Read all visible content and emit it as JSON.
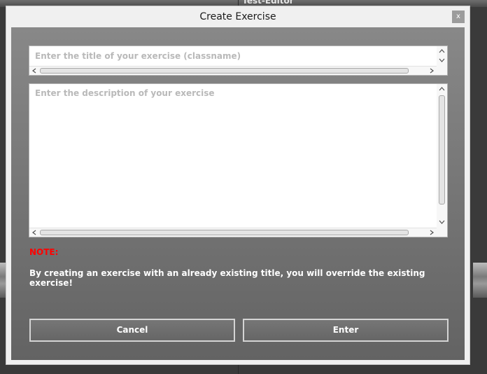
{
  "background": {
    "window_title": "Test-Editor"
  },
  "dialog": {
    "title": "Create Exercise",
    "close_label": "x",
    "title_field": {
      "value": "",
      "placeholder": "Enter the title of your exercise (classname)"
    },
    "description_field": {
      "value": "",
      "placeholder": "Enter the description of your exercise"
    },
    "note_label": "NOTE:",
    "note_text": "By creating an exercise with an already existing title, you will override the existing exercise!",
    "cancel_label": "Cancel",
    "enter_label": "Enter"
  },
  "icons": {
    "scroll_up": "chevron-up-icon",
    "scroll_down": "chevron-down-icon",
    "scroll_left": "chevron-left-icon",
    "scroll_right": "chevron-right-icon"
  },
  "colors": {
    "note_label": "#ff0000",
    "content_top": "#888888",
    "content_bottom": "#636363",
    "button_border": "#d4d4d4"
  }
}
